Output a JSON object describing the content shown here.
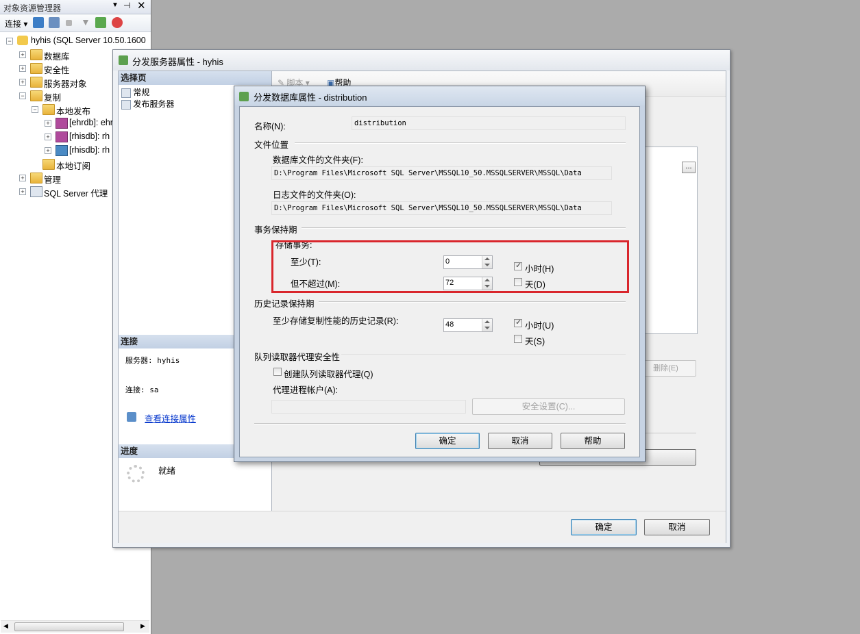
{
  "object_explorer": {
    "title": "对象资源管理器",
    "connect_label": "连接",
    "tree": [
      {
        "label": "hyhis (SQL Server 10.50.1600"
      },
      {
        "label": "数据库"
      },
      {
        "label": "安全性"
      },
      {
        "label": "服务器对象"
      },
      {
        "label": "复制"
      },
      {
        "label": "本地发布"
      },
      {
        "label": "[ehrdb]: ehr"
      },
      {
        "label": "[rhisdb]: rh"
      },
      {
        "label": "[rhisdb]: rh"
      },
      {
        "label": "本地订阅"
      },
      {
        "label": "管理"
      },
      {
        "label": "SQL Server 代理"
      }
    ]
  },
  "dist_server_dialog": {
    "title": "分发服务器属性 - hyhis",
    "select_page_header": "选择页",
    "pages": [
      "常规",
      "发布服务器"
    ],
    "toolbar": {
      "script_label": "脚本",
      "help_label": "帮助"
    },
    "connection_header": "连接",
    "server_label": "服务器: hyhis",
    "connection_label": "连接: sa",
    "view_conn_link": "查看连接属性",
    "progress_header": "进度",
    "progress_status": "就绪",
    "browse_button": "...",
    "delete_button": "删除(E)",
    "ok_button": "确定",
    "cancel_button": "取消"
  },
  "dist_db_dialog": {
    "title": "分发数据库属性 - distribution",
    "name_label": "名称(N):",
    "name_value": "distribution",
    "file_location_group": "文件位置",
    "data_folder_label": "数据库文件的文件夹(F):",
    "data_folder_value": "D:\\Program Files\\Microsoft SQL Server\\MSSQL10_50.MSSQLSERVER\\MSSQL\\Data",
    "log_folder_label": "日志文件的文件夹(O):",
    "log_folder_value": "D:\\Program Files\\Microsoft SQL Server\\MSSQL10_50.MSSQLSERVER\\MSSQL\\Data",
    "txn_retention_group": "事务保持期",
    "store_txn_label": "存储事务:",
    "at_least_label": "至少(T):",
    "at_least_value": "0",
    "not_more_label": "但不超过(M):",
    "not_more_value": "72",
    "hours_label": "小时(H)",
    "days_label": "天(D)",
    "hours_checked": true,
    "days_checked": false,
    "history_group": "历史记录保持期",
    "history_label": "至少存储复制性能的历史记录(R):",
    "history_value": "48",
    "history_hours_label": "小时(U)",
    "history_days_label": "天(S)",
    "queue_security_group": "队列读取器代理安全性",
    "create_queue_agent_label": "创建队列读取器代理(Q)",
    "agent_account_label": "代理进程帐户(A):",
    "security_settings_button": "安全设置(C)...",
    "ok_button": "确定",
    "cancel_button": "取消",
    "help_button": "帮助"
  },
  "highlight_color": "#d9262c"
}
